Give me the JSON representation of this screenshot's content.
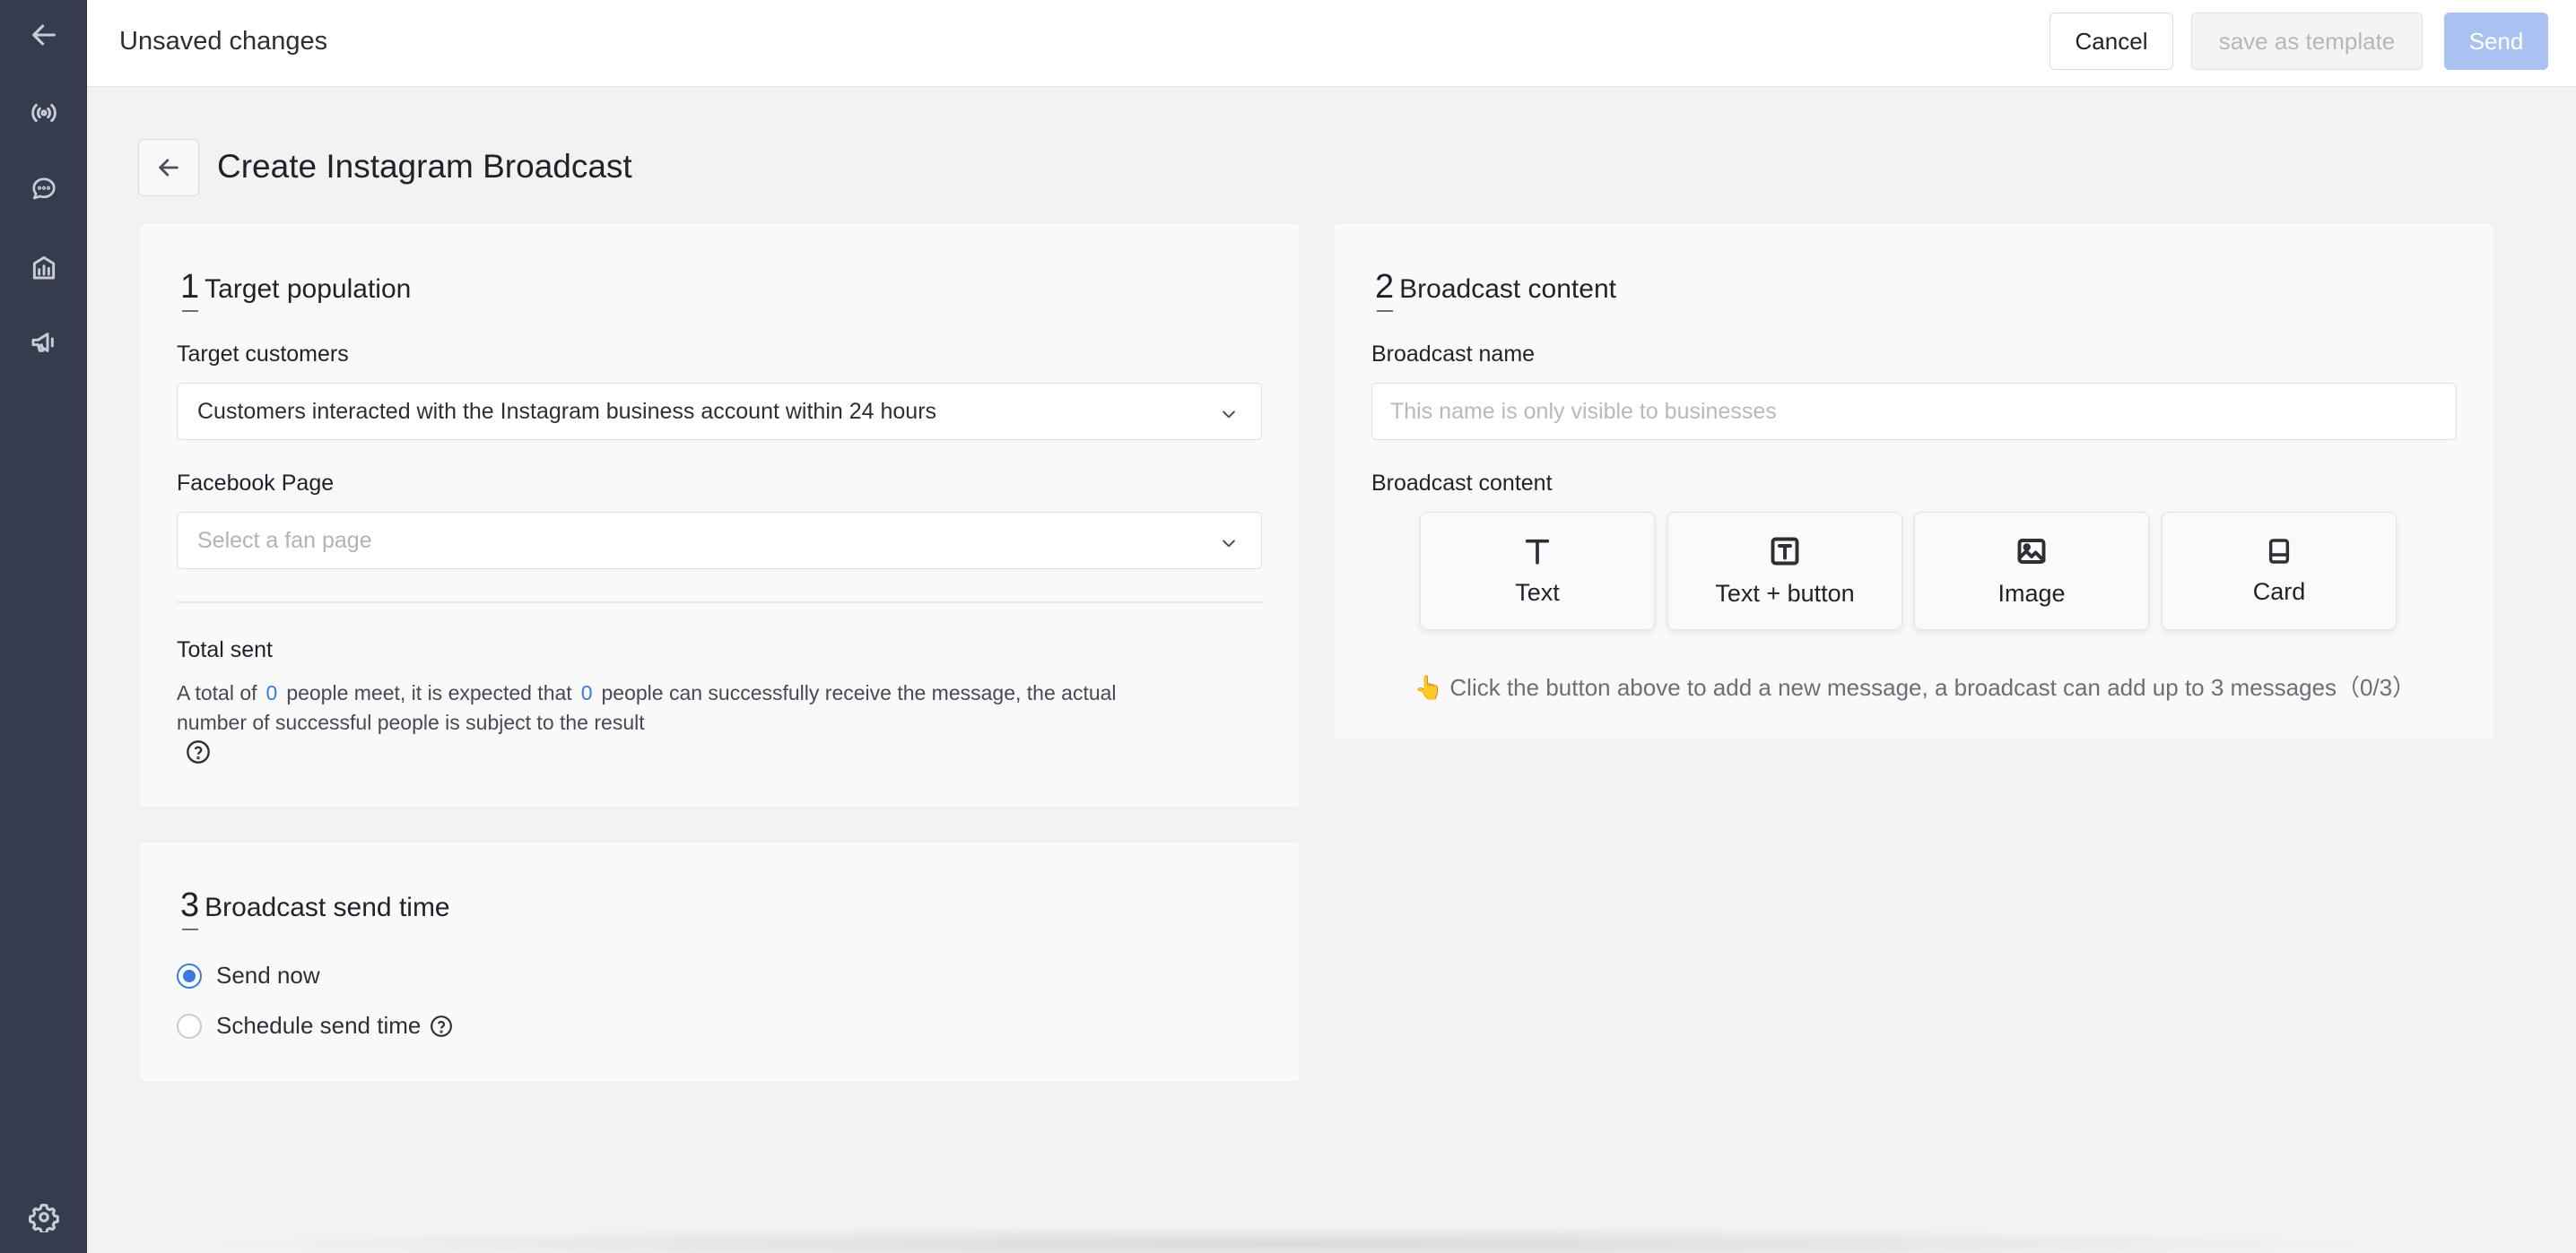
{
  "topbar": {
    "title": "Unsaved changes",
    "cancel_label": "Cancel",
    "template_label": "save as template",
    "send_label": "Send"
  },
  "sidebar": {
    "items": [
      {
        "icon": "arrow-left-icon"
      },
      {
        "icon": "broadcast-icon"
      },
      {
        "icon": "chat-icon"
      },
      {
        "icon": "analytics-icon"
      },
      {
        "icon": "megaphone-icon"
      },
      {
        "icon": "gear-icon"
      }
    ]
  },
  "page": {
    "title": "Create Instagram Broadcast"
  },
  "target": {
    "num": "1",
    "heading": "Target population",
    "customers_label": "Target customers",
    "customers_value": "Customers interacted with the Instagram business account within 24 hours",
    "page_label": "Facebook Page",
    "page_placeholder": "Select a fan page",
    "total_label": "Total sent",
    "total_prefix": "A total of",
    "total_people": "0",
    "total_middle": "people meet, it is expected that",
    "total_success": "0",
    "total_suffix": "people can successfully receive the message, the actual",
    "total_line2": "number of successful people is subject to the result"
  },
  "content": {
    "num": "2",
    "heading": "Broadcast content",
    "name_label": "Broadcast name",
    "name_placeholder": "This name is only visible to businesses",
    "content_label": "Broadcast content",
    "types": [
      "Text",
      "Text + button",
      "Image",
      "Card"
    ],
    "hint": "👆 Click the button above to add a new message, a broadcast can add up to 3 messages（0/3）"
  },
  "send_time": {
    "num": "3",
    "heading": "Broadcast send time",
    "options": [
      "Send now",
      "Schedule send time"
    ],
    "selected": "Send now"
  },
  "colors": {
    "sidebar": "#353c4d",
    "accent": "#3a7be0",
    "send_disabled": "#a9c2f2"
  }
}
